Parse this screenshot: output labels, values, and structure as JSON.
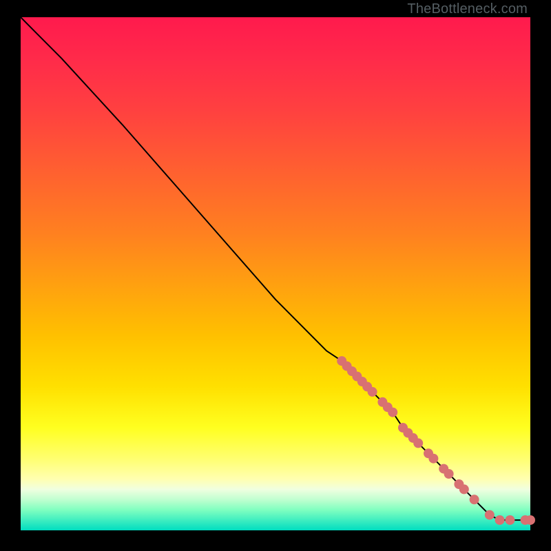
{
  "watermark": "TheBottleneck.com",
  "chart_data": {
    "type": "line",
    "title": "",
    "xlabel": "",
    "ylabel": "",
    "x_range": [
      0,
      100
    ],
    "y_range": [
      0,
      100
    ],
    "background_gradient_meaning": "red (high) to green (low) — lower is better",
    "curve": {
      "name": "bottleneck-curve",
      "comment": "y decreases roughly linearly with x from (0,100) to (~98,0); points are x (normalized 0-100) and y (value read off vertical position)",
      "points": [
        {
          "x": 0,
          "y": 100
        },
        {
          "x": 3,
          "y": 97
        },
        {
          "x": 8,
          "y": 92
        },
        {
          "x": 20,
          "y": 79
        },
        {
          "x": 35,
          "y": 62
        },
        {
          "x": 50,
          "y": 45
        },
        {
          "x": 60,
          "y": 35
        },
        {
          "x": 63,
          "y": 33
        },
        {
          "x": 64,
          "y": 32
        },
        {
          "x": 65,
          "y": 31
        },
        {
          "x": 66,
          "y": 30
        },
        {
          "x": 67,
          "y": 29
        },
        {
          "x": 68,
          "y": 28
        },
        {
          "x": 69,
          "y": 27
        },
        {
          "x": 71,
          "y": 25
        },
        {
          "x": 72,
          "y": 24
        },
        {
          "x": 73,
          "y": 23
        },
        {
          "x": 75,
          "y": 20
        },
        {
          "x": 76,
          "y": 19
        },
        {
          "x": 77,
          "y": 18
        },
        {
          "x": 78,
          "y": 17
        },
        {
          "x": 80,
          "y": 15
        },
        {
          "x": 81,
          "y": 14
        },
        {
          "x": 83,
          "y": 12
        },
        {
          "x": 84,
          "y": 11
        },
        {
          "x": 86,
          "y": 9
        },
        {
          "x": 87,
          "y": 8
        },
        {
          "x": 89,
          "y": 6
        },
        {
          "x": 90,
          "y": 5
        },
        {
          "x": 92,
          "y": 3
        },
        {
          "x": 94,
          "y": 2
        },
        {
          "x": 96,
          "y": 2
        },
        {
          "x": 97,
          "y": 2
        },
        {
          "x": 99,
          "y": 2
        },
        {
          "x": 100,
          "y": 2
        }
      ]
    },
    "markers": {
      "comment": "salmon-colored dots placed along the curve in the lower-right region",
      "points_x": [
        63,
        64,
        65,
        66,
        67,
        68,
        69,
        71,
        72,
        73,
        75,
        76,
        77,
        78,
        80,
        81,
        83,
        84,
        86,
        87,
        89,
        92,
        94,
        96,
        99,
        100
      ],
      "approx_y_for_markers": [
        33,
        32,
        31,
        30,
        29,
        28,
        27,
        25,
        24,
        23,
        20,
        19,
        18,
        17,
        15,
        14,
        12,
        11,
        9,
        8,
        6,
        3,
        2,
        2,
        2,
        2
      ]
    }
  }
}
